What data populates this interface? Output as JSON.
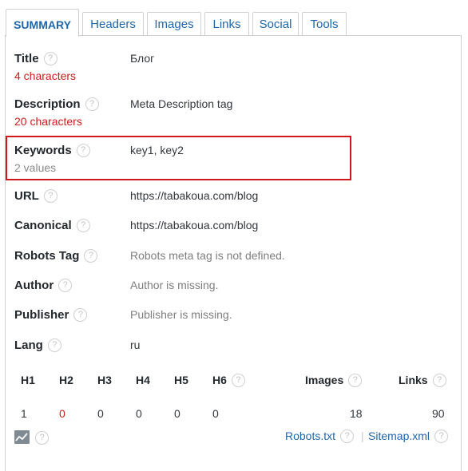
{
  "tabs": [
    {
      "label": "SUMMARY"
    },
    {
      "label": "Headers"
    },
    {
      "label": "Images"
    },
    {
      "label": "Links"
    },
    {
      "label": "Social"
    },
    {
      "label": "Tools"
    }
  ],
  "help_glyph": "?",
  "rows": {
    "title": {
      "label": "Title",
      "sub": "4 characters",
      "value": "Блог"
    },
    "description": {
      "label": "Description",
      "sub": "20 characters",
      "value": "Meta Description tag"
    },
    "keywords": {
      "label": "Keywords",
      "sub": "2 values",
      "value": "key1, key2"
    },
    "url": {
      "label": "URL",
      "value": "https://tabakoua.com/blog"
    },
    "canonical": {
      "label": "Canonical",
      "value": "https://tabakoua.com/blog"
    },
    "robots": {
      "label": "Robots Tag",
      "value": "Robots meta tag is not defined."
    },
    "author": {
      "label": "Author",
      "value": "Author is missing."
    },
    "publisher": {
      "label": "Publisher",
      "value": "Publisher is missing."
    },
    "lang": {
      "label": "Lang",
      "value": "ru"
    }
  },
  "headings": {
    "h1": {
      "label": "H1",
      "value": "1"
    },
    "h2": {
      "label": "H2",
      "value": "0"
    },
    "h3": {
      "label": "H3",
      "value": "0"
    },
    "h4": {
      "label": "H4",
      "value": "0"
    },
    "h5": {
      "label": "H5",
      "value": "0"
    },
    "h6": {
      "label": "H6",
      "value": "0"
    },
    "images": {
      "label": "Images",
      "value": "18"
    },
    "links": {
      "label": "Links",
      "value": "90"
    }
  },
  "footer": {
    "chart_icon": "line-chart-icon",
    "robots_link": "Robots.txt",
    "separator": "|",
    "sitemap_link": "Sitemap.xml"
  },
  "colors": {
    "link": "#1f66a9",
    "warning": "#d11a1a",
    "highlight_border": "#d0181d"
  }
}
